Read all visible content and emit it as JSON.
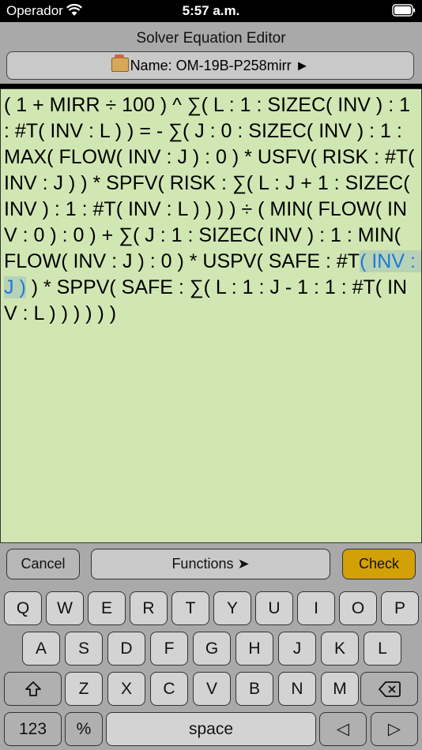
{
  "status": {
    "carrier": "Operador",
    "time": "5:57 a.m."
  },
  "header": {
    "title": "Solver Equation Editor",
    "name_button": "Name: OM-19B-P258mirr ►"
  },
  "editor": {
    "equation_before": "( 1 + MIRR ÷ 100 ) ^ ∑( L : 1 : SIZEC( INV ) : 1 : #T( INV : L ) ) = - ∑( J : 0 : SIZEC( INV ) : 1 : MAX( FLOW( INV : J ) : 0 ) * USFV( RISK : #T( INV : J ) ) * SPFV( RISK : ∑( L : J + 1 : SIZEC( INV ) : 1 : #T( INV : L ) ) ) ) ÷ ( MIN( FLOW( INV : 0 ) : 0 ) + ∑( J : 1 : SIZEC( INV ) : 1 : MIN( FLOW( INV : J ) : 0 ) * USPV( SAFE : #T",
    "equation_selected": "( INV : J )",
    "equation_after": " ) * SPPV( SAFE : ∑( L : 1 : J - 1 : 1 : #T( INV : L ) ) ) ) ) )"
  },
  "bottombar": {
    "cancel": "Cancel",
    "functions": "Functions ➤",
    "check": "Check"
  },
  "keyboard": {
    "row1": [
      "Q",
      "W",
      "E",
      "R",
      "T",
      "Y",
      "U",
      "I",
      "O",
      "P"
    ],
    "row2": [
      "A",
      "S",
      "D",
      "F",
      "G",
      "H",
      "J",
      "K",
      "L"
    ],
    "row3": [
      "Z",
      "X",
      "C",
      "V",
      "B",
      "N",
      "M"
    ],
    "shift": "⇧",
    "backspace": "⌫",
    "numbers": "123",
    "percent": "%",
    "space": "space",
    "left": "◁",
    "right": "▷"
  },
  "colors": {
    "editor_bg": "#d1e7b3",
    "check_bg": "#d4a007",
    "selection_text": "#1a7bd8"
  }
}
